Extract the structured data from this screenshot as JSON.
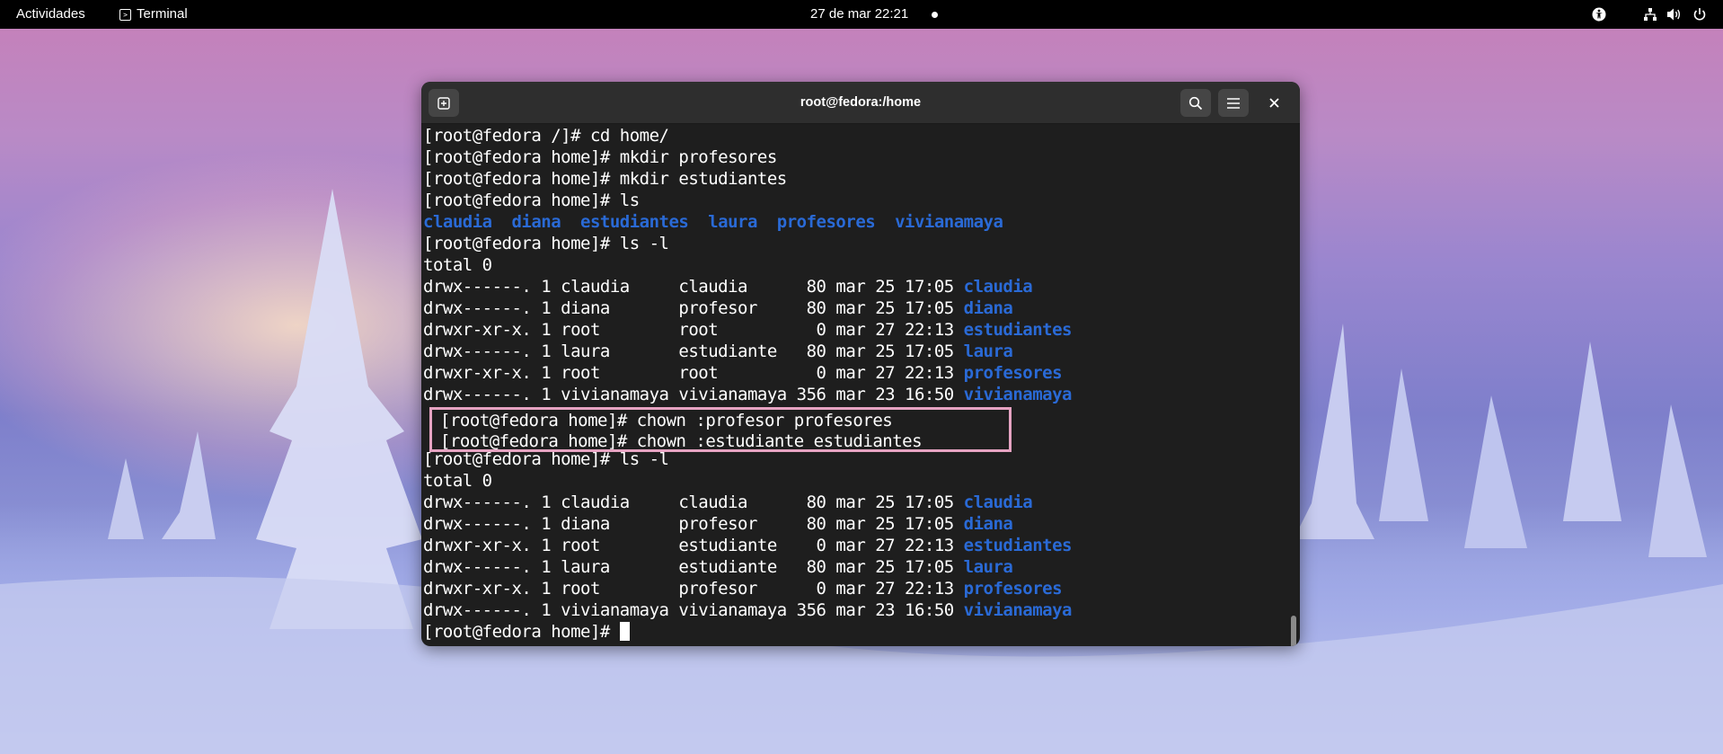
{
  "topbar": {
    "activities": "Actividades",
    "app_name": "Terminal",
    "clock": "27 de mar  22:21"
  },
  "window": {
    "title": "root@fedora:/home"
  },
  "terminal": {
    "lines": [
      "[root@fedora /]# cd home/",
      "[root@fedora home]# mkdir profesores",
      "[root@fedora home]# mkdir estudiantes",
      "[root@fedora home]# ls",
      "",
      "[root@fedora home]# ls -l",
      "total 0",
      "drwx------. 1 claudia     claudia      80 mar 25 17:05 ",
      "drwx------. 1 diana       profesor     80 mar 25 17:05 ",
      "drwxr-xr-x. 1 root        root          0 mar 27 22:13 ",
      "drwx------. 1 laura       estudiante   80 mar 25 17:05 ",
      "drwxr-xr-x. 1 root        root          0 mar 27 22:13 ",
      "drwx------. 1 vivianamaya vivianamaya 356 mar 23 16:50 ",
      "[root@fedora home]# chown :profesor profesores",
      "[root@fedora home]# chown :estudiante estudiantes",
      "[root@fedora home]# ls -l",
      "total 0",
      "drwx------. 1 claudia     claudia      80 mar 25 17:05 ",
      "drwx------. 1 diana       profesor     80 mar 25 17:05 ",
      "drwxr-xr-x. 1 root        estudiante    0 mar 27 22:13 ",
      "drwx------. 1 laura       estudiante   80 mar 25 17:05 ",
      "drwxr-xr-x. 1 root        profesor      0 mar 27 22:13 ",
      "drwx------. 1 vivianamaya vivianamaya 356 mar 23 16:50 ",
      "[root@fedora home]# "
    ],
    "ls_output": "claudia  diana  estudiantes  laura  profesores  vivianamaya",
    "dirnames": [
      "claudia",
      "diana",
      "estudiantes",
      "laura",
      "profesores",
      "vivianamaya"
    ],
    "dir_color": "#2a6ad6",
    "highlight_color": "#e6a3c2"
  },
  "icons": {
    "new_tab": "new-tab-icon",
    "search": "search-icon",
    "menu": "hamburger-menu-icon",
    "close": "close-icon",
    "accessibility": "accessibility-icon",
    "network": "network-icon",
    "volume": "volume-icon",
    "power": "power-icon"
  }
}
